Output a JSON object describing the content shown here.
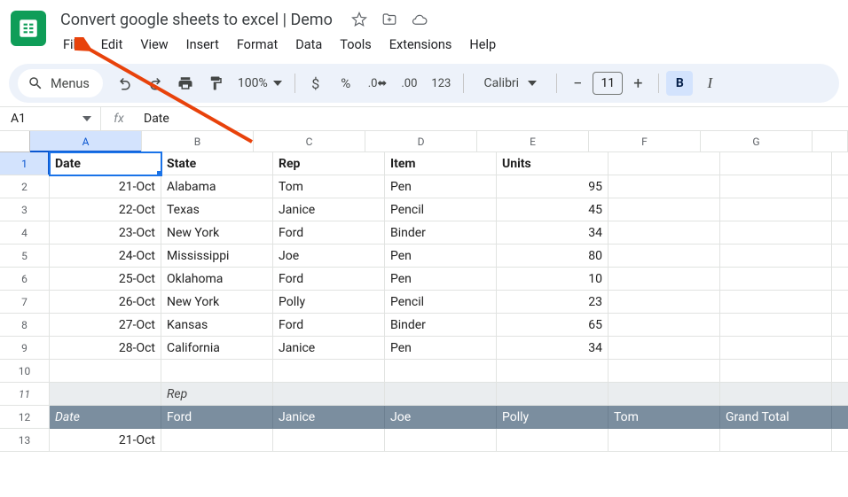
{
  "doc": {
    "title": "Convert google sheets to excel | Demo"
  },
  "menus": [
    "File",
    "Edit",
    "View",
    "Insert",
    "Format",
    "Data",
    "Tools",
    "Extensions",
    "Help"
  ],
  "toolbar": {
    "search_label": "Menus",
    "zoom": "100%",
    "font": "Calibri",
    "font_size": "11"
  },
  "namebox": "A1",
  "formula_value": "Date",
  "columns": [
    "A",
    "B",
    "C",
    "D",
    "E",
    "F",
    "G",
    ""
  ],
  "rows": [
    {
      "n": "1",
      "sel": true,
      "cells": [
        {
          "t": "Date",
          "cls": "bold active-cell"
        },
        {
          "t": "State",
          "cls": "bold"
        },
        {
          "t": "Rep",
          "cls": "bold"
        },
        {
          "t": "Item",
          "cls": "bold"
        },
        {
          "t": "Units",
          "cls": "bold"
        },
        {
          "t": ""
        },
        {
          "t": ""
        },
        {
          "t": ""
        }
      ]
    },
    {
      "n": "2",
      "cells": [
        {
          "t": "21-Oct",
          "cls": "right"
        },
        {
          "t": "Alabama"
        },
        {
          "t": "Tom"
        },
        {
          "t": "Pen"
        },
        {
          "t": "95",
          "cls": "right"
        },
        {
          "t": ""
        },
        {
          "t": ""
        },
        {
          "t": ""
        }
      ]
    },
    {
      "n": "3",
      "cells": [
        {
          "t": "22-Oct",
          "cls": "right"
        },
        {
          "t": "Texas"
        },
        {
          "t": "Janice"
        },
        {
          "t": "Pencil"
        },
        {
          "t": "45",
          "cls": "right"
        },
        {
          "t": ""
        },
        {
          "t": ""
        },
        {
          "t": ""
        }
      ]
    },
    {
      "n": "4",
      "cells": [
        {
          "t": "23-Oct",
          "cls": "right"
        },
        {
          "t": "New York"
        },
        {
          "t": "Ford"
        },
        {
          "t": "Binder"
        },
        {
          "t": "34",
          "cls": "right"
        },
        {
          "t": ""
        },
        {
          "t": ""
        },
        {
          "t": ""
        }
      ]
    },
    {
      "n": "5",
      "cells": [
        {
          "t": "24-Oct",
          "cls": "right"
        },
        {
          "t": "Mississippi"
        },
        {
          "t": "Joe"
        },
        {
          "t": "Pen"
        },
        {
          "t": "80",
          "cls": "right"
        },
        {
          "t": ""
        },
        {
          "t": ""
        },
        {
          "t": ""
        }
      ]
    },
    {
      "n": "6",
      "cells": [
        {
          "t": "25-Oct",
          "cls": "right"
        },
        {
          "t": "Oklahoma"
        },
        {
          "t": "Ford"
        },
        {
          "t": "Pen"
        },
        {
          "t": "10",
          "cls": "right"
        },
        {
          "t": ""
        },
        {
          "t": ""
        },
        {
          "t": ""
        }
      ]
    },
    {
      "n": "7",
      "cells": [
        {
          "t": "26-Oct",
          "cls": "right"
        },
        {
          "t": "New York"
        },
        {
          "t": "Polly"
        },
        {
          "t": "Pencil"
        },
        {
          "t": "23",
          "cls": "right"
        },
        {
          "t": ""
        },
        {
          "t": ""
        },
        {
          "t": ""
        }
      ]
    },
    {
      "n": "8",
      "cells": [
        {
          "t": "27-Oct",
          "cls": "right"
        },
        {
          "t": "Kansas"
        },
        {
          "t": "Ford"
        },
        {
          "t": "Binder"
        },
        {
          "t": "65",
          "cls": "right"
        },
        {
          "t": ""
        },
        {
          "t": ""
        },
        {
          "t": ""
        }
      ]
    },
    {
      "n": "9",
      "cells": [
        {
          "t": "28-Oct",
          "cls": "right"
        },
        {
          "t": "California"
        },
        {
          "t": "Janice"
        },
        {
          "t": "Pen"
        },
        {
          "t": "34",
          "cls": "right"
        },
        {
          "t": ""
        },
        {
          "t": ""
        },
        {
          "t": ""
        }
      ]
    },
    {
      "n": "10",
      "cells": [
        {
          "t": ""
        },
        {
          "t": ""
        },
        {
          "t": ""
        },
        {
          "t": ""
        },
        {
          "t": ""
        },
        {
          "t": ""
        },
        {
          "t": ""
        },
        {
          "t": ""
        }
      ]
    },
    {
      "n": "11",
      "rowcls": "pivot-hdr",
      "cells": [
        {
          "t": ""
        },
        {
          "t": "Rep",
          "cls": ""
        },
        {
          "t": ""
        },
        {
          "t": ""
        },
        {
          "t": ""
        },
        {
          "t": ""
        },
        {
          "t": ""
        },
        {
          "t": ""
        }
      ]
    },
    {
      "n": "12",
      "rowcls": "pivot-row",
      "cells": [
        {
          "t": "Date",
          "cls": ""
        },
        {
          "t": "Ford"
        },
        {
          "t": "Janice"
        },
        {
          "t": "Joe"
        },
        {
          "t": "Polly"
        },
        {
          "t": "Tom"
        },
        {
          "t": "Grand Total"
        },
        {
          "t": ""
        }
      ]
    },
    {
      "n": "13",
      "cells": [
        {
          "t": "21-Oct",
          "cls": "right"
        },
        {
          "t": ""
        },
        {
          "t": ""
        },
        {
          "t": ""
        },
        {
          "t": ""
        },
        {
          "t": ""
        },
        {
          "t": ""
        },
        {
          "t": ""
        }
      ]
    }
  ]
}
